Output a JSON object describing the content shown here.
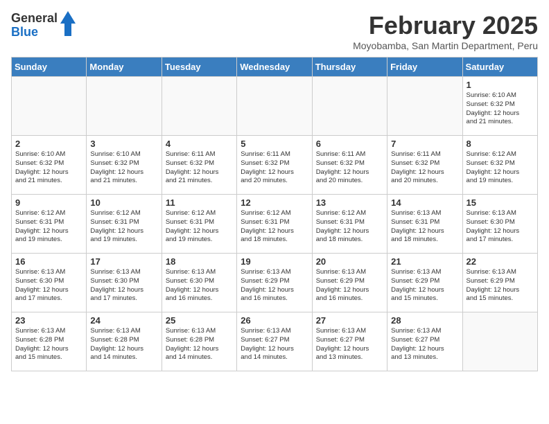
{
  "header": {
    "logo_line1": "General",
    "logo_line2": "Blue",
    "month_title": "February 2025",
    "subtitle": "Moyobamba, San Martin Department, Peru"
  },
  "weekdays": [
    "Sunday",
    "Monday",
    "Tuesday",
    "Wednesday",
    "Thursday",
    "Friday",
    "Saturday"
  ],
  "weeks": [
    [
      {
        "day": "",
        "info": ""
      },
      {
        "day": "",
        "info": ""
      },
      {
        "day": "",
        "info": ""
      },
      {
        "day": "",
        "info": ""
      },
      {
        "day": "",
        "info": ""
      },
      {
        "day": "",
        "info": ""
      },
      {
        "day": "1",
        "info": "Sunrise: 6:10 AM\nSunset: 6:32 PM\nDaylight: 12 hours\nand 21 minutes."
      }
    ],
    [
      {
        "day": "2",
        "info": "Sunrise: 6:10 AM\nSunset: 6:32 PM\nDaylight: 12 hours\nand 21 minutes."
      },
      {
        "day": "3",
        "info": "Sunrise: 6:10 AM\nSunset: 6:32 PM\nDaylight: 12 hours\nand 21 minutes."
      },
      {
        "day": "4",
        "info": "Sunrise: 6:11 AM\nSunset: 6:32 PM\nDaylight: 12 hours\nand 21 minutes."
      },
      {
        "day": "5",
        "info": "Sunrise: 6:11 AM\nSunset: 6:32 PM\nDaylight: 12 hours\nand 20 minutes."
      },
      {
        "day": "6",
        "info": "Sunrise: 6:11 AM\nSunset: 6:32 PM\nDaylight: 12 hours\nand 20 minutes."
      },
      {
        "day": "7",
        "info": "Sunrise: 6:11 AM\nSunset: 6:32 PM\nDaylight: 12 hours\nand 20 minutes."
      },
      {
        "day": "8",
        "info": "Sunrise: 6:12 AM\nSunset: 6:32 PM\nDaylight: 12 hours\nand 19 minutes."
      }
    ],
    [
      {
        "day": "9",
        "info": "Sunrise: 6:12 AM\nSunset: 6:31 PM\nDaylight: 12 hours\nand 19 minutes."
      },
      {
        "day": "10",
        "info": "Sunrise: 6:12 AM\nSunset: 6:31 PM\nDaylight: 12 hours\nand 19 minutes."
      },
      {
        "day": "11",
        "info": "Sunrise: 6:12 AM\nSunset: 6:31 PM\nDaylight: 12 hours\nand 19 minutes."
      },
      {
        "day": "12",
        "info": "Sunrise: 6:12 AM\nSunset: 6:31 PM\nDaylight: 12 hours\nand 18 minutes."
      },
      {
        "day": "13",
        "info": "Sunrise: 6:12 AM\nSunset: 6:31 PM\nDaylight: 12 hours\nand 18 minutes."
      },
      {
        "day": "14",
        "info": "Sunrise: 6:13 AM\nSunset: 6:31 PM\nDaylight: 12 hours\nand 18 minutes."
      },
      {
        "day": "15",
        "info": "Sunrise: 6:13 AM\nSunset: 6:30 PM\nDaylight: 12 hours\nand 17 minutes."
      }
    ],
    [
      {
        "day": "16",
        "info": "Sunrise: 6:13 AM\nSunset: 6:30 PM\nDaylight: 12 hours\nand 17 minutes."
      },
      {
        "day": "17",
        "info": "Sunrise: 6:13 AM\nSunset: 6:30 PM\nDaylight: 12 hours\nand 17 minutes."
      },
      {
        "day": "18",
        "info": "Sunrise: 6:13 AM\nSunset: 6:30 PM\nDaylight: 12 hours\nand 16 minutes."
      },
      {
        "day": "19",
        "info": "Sunrise: 6:13 AM\nSunset: 6:29 PM\nDaylight: 12 hours\nand 16 minutes."
      },
      {
        "day": "20",
        "info": "Sunrise: 6:13 AM\nSunset: 6:29 PM\nDaylight: 12 hours\nand 16 minutes."
      },
      {
        "day": "21",
        "info": "Sunrise: 6:13 AM\nSunset: 6:29 PM\nDaylight: 12 hours\nand 15 minutes."
      },
      {
        "day": "22",
        "info": "Sunrise: 6:13 AM\nSunset: 6:29 PM\nDaylight: 12 hours\nand 15 minutes."
      }
    ],
    [
      {
        "day": "23",
        "info": "Sunrise: 6:13 AM\nSunset: 6:28 PM\nDaylight: 12 hours\nand 15 minutes."
      },
      {
        "day": "24",
        "info": "Sunrise: 6:13 AM\nSunset: 6:28 PM\nDaylight: 12 hours\nand 14 minutes."
      },
      {
        "day": "25",
        "info": "Sunrise: 6:13 AM\nSunset: 6:28 PM\nDaylight: 12 hours\nand 14 minutes."
      },
      {
        "day": "26",
        "info": "Sunrise: 6:13 AM\nSunset: 6:27 PM\nDaylight: 12 hours\nand 14 minutes."
      },
      {
        "day": "27",
        "info": "Sunrise: 6:13 AM\nSunset: 6:27 PM\nDaylight: 12 hours\nand 13 minutes."
      },
      {
        "day": "28",
        "info": "Sunrise: 6:13 AM\nSunset: 6:27 PM\nDaylight: 12 hours\nand 13 minutes."
      },
      {
        "day": "",
        "info": ""
      }
    ]
  ]
}
